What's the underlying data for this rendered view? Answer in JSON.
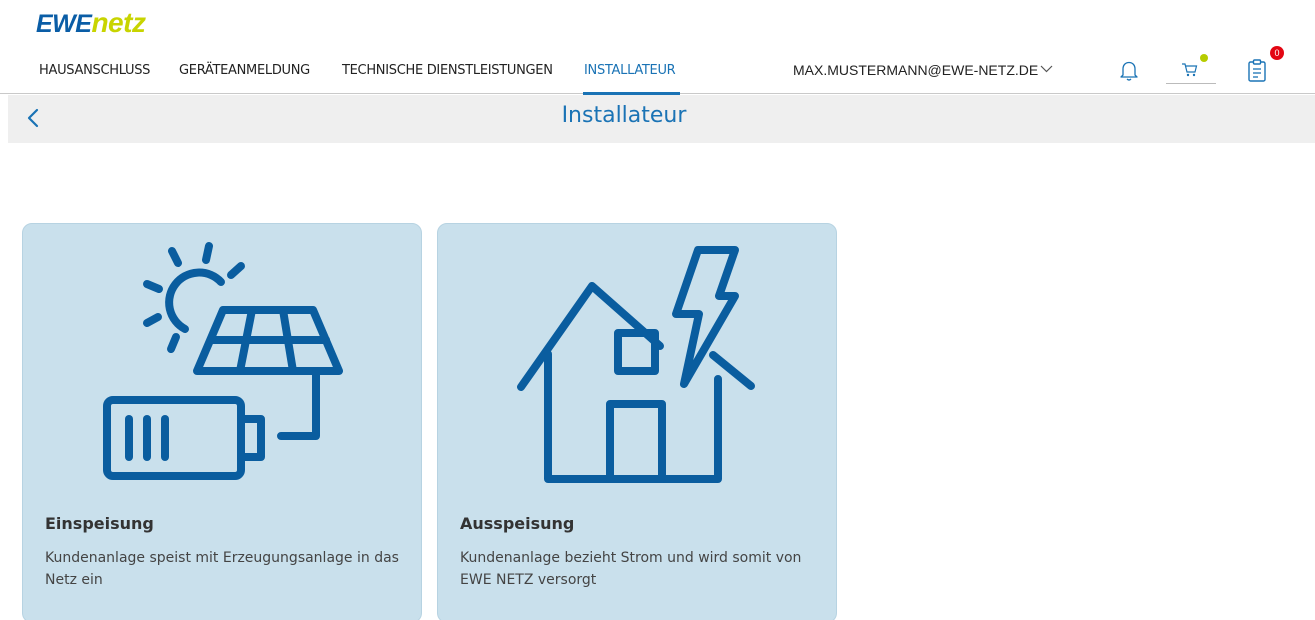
{
  "logo": {
    "part1": "EWE",
    "part2": "netz"
  },
  "nav": {
    "items": [
      {
        "label": "HAUSANSCHLUSS"
      },
      {
        "label": "GERÄTEANMELDUNG"
      },
      {
        "label": "TECHNISCHE DIENSTLEISTUNGEN"
      },
      {
        "label": "INSTALLATEUR",
        "active": true
      }
    ],
    "user_email": "MAX.MUSTERMANN@EWE-NETZ.DE",
    "clipboard_badge": "0"
  },
  "subheader": {
    "title": "Installateur"
  },
  "cards": [
    {
      "title": "Einspeisung",
      "description": "Kundenanlage speist mit Erzeugungsanlage in das Netz ein",
      "icon": "solar-battery-icon"
    },
    {
      "title": "Ausspeisung",
      "description": "Kundenanlage bezieht Strom und wird somit von EWE NETZ versorgt",
      "icon": "house-lightning-icon"
    }
  ],
  "colors": {
    "primary": "#1a73b5",
    "logo_blue": "#0a5da6",
    "logo_green": "#c8d400",
    "card_bg": "#c9e0ec",
    "icon_blue": "#0a5d9f",
    "badge_red": "#e30613"
  }
}
